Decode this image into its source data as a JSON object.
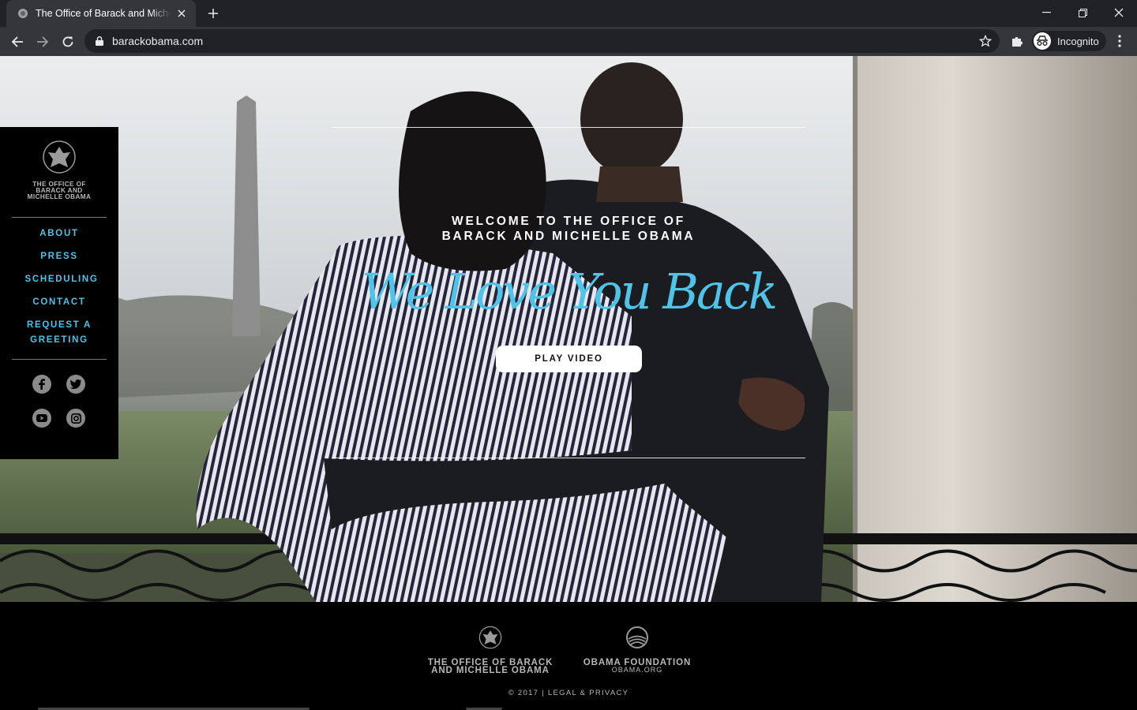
{
  "browser": {
    "tab_title": "The Office of Barack and Michelle Obama",
    "url": "barackobama.com",
    "incognito_label": "Incognito",
    "icons": [
      "seal-favicon-icon",
      "close-icon",
      "plus-icon",
      "minimize-icon",
      "restore-icon",
      "close-window-icon",
      "back-arrow-icon",
      "forward-arrow-icon",
      "reload-icon",
      "lock-icon",
      "star-icon",
      "puzzle-extension-icon",
      "incognito-icon",
      "kebab-menu-icon"
    ]
  },
  "sidenav": {
    "brand": [
      "THE OFFICE OF",
      "BARACK AND",
      "MICHELLE OBAMA"
    ],
    "links": [
      "ABOUT",
      "PRESS",
      "SCHEDULING",
      "CONTACT",
      "REQUEST A",
      "GREETING"
    ],
    "social": [
      "facebook-icon",
      "twitter-icon",
      "youtube-icon",
      "instagram-icon"
    ],
    "link_color": "#4fc3e8"
  },
  "hero": {
    "welcome": [
      "WELCOME TO THE OFFICE OF",
      "BARACK AND MICHELLE OBAMA"
    ],
    "tagline": "We Love You Back",
    "play_label": "PLAY VIDEO",
    "accent": "#4fc3e8"
  },
  "footer": {
    "office": [
      "THE OFFICE OF BARACK",
      "AND MICHELLE OBAMA"
    ],
    "foundation": "OBAMA FOUNDATION",
    "foundation_site": "OBAMA.ORG",
    "copyright": "© 2017 | LEGAL & PRIVACY"
  }
}
